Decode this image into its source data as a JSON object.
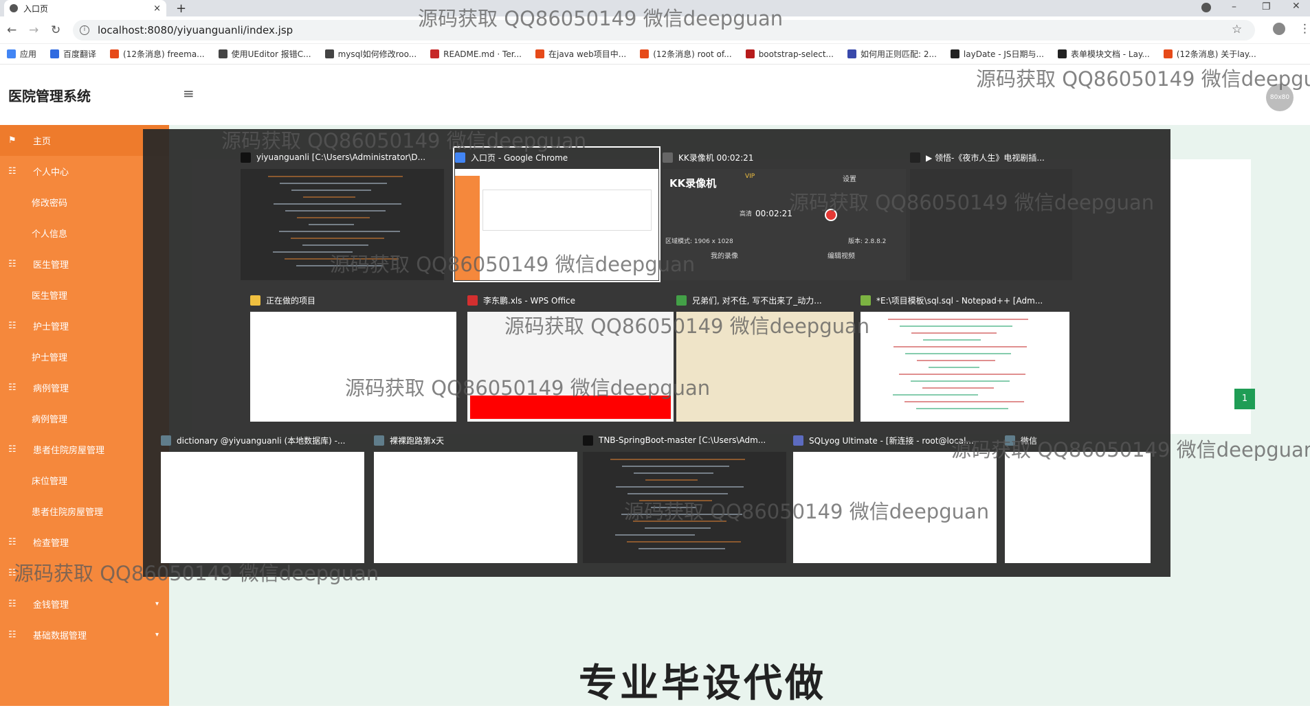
{
  "browser": {
    "tab_title": "入口页",
    "tab_close": "×",
    "new_tab": "+",
    "url": "localhost:8080/yiyuanguanli/index.jsp",
    "bookmarks": [
      {
        "label": "应用",
        "color": "#4285f4"
      },
      {
        "label": "百度翻译",
        "color": "#2f6ae0"
      },
      {
        "label": "(12条消息) freema...",
        "color": "#e64a19"
      },
      {
        "label": "使用UEditor 报错C...",
        "color": "#444444"
      },
      {
        "label": "mysql如何修改roo...",
        "color": "#444444"
      },
      {
        "label": "README.md · Ter...",
        "color": "#c62828"
      },
      {
        "label": "在java web项目中...",
        "color": "#e64a19"
      },
      {
        "label": "(12条消息) root of...",
        "color": "#e64a19"
      },
      {
        "label": "bootstrap-select...",
        "color": "#b71c1c"
      },
      {
        "label": "如何用正则匹配: 2...",
        "color": "#3949ab"
      },
      {
        "label": "layDate - JS日期与...",
        "color": "#222222"
      },
      {
        "label": "表单模块文档 - Lay...",
        "color": "#222222"
      },
      {
        "label": "(12条消息) 关于lay...",
        "color": "#e64a19"
      }
    ]
  },
  "app": {
    "brand": "医院管理系统",
    "avatar_text": "80x80",
    "menu": [
      {
        "label": "主页",
        "type": "top",
        "icon": "flag-icon"
      },
      {
        "label": "个人中心",
        "type": "group"
      },
      {
        "label": "修改密码",
        "type": "sub"
      },
      {
        "label": "个人信息",
        "type": "sub"
      },
      {
        "label": "医生管理",
        "type": "group"
      },
      {
        "label": "医生管理",
        "type": "sub"
      },
      {
        "label": "护士管理",
        "type": "group"
      },
      {
        "label": "护士管理",
        "type": "sub"
      },
      {
        "label": "病例管理",
        "type": "group"
      },
      {
        "label": "病例管理",
        "type": "sub"
      },
      {
        "label": "患者住院房屋管理",
        "type": "group"
      },
      {
        "label": "床位管理",
        "type": "sub"
      },
      {
        "label": "患者住院房屋管理",
        "type": "sub"
      },
      {
        "label": "检查管理",
        "type": "group"
      },
      {
        "label": "",
        "type": "group"
      },
      {
        "label": "金钱管理",
        "type": "group",
        "arrow": true
      },
      {
        "label": "基础数据管理",
        "type": "group",
        "arrow": true
      }
    ],
    "pagination_current": "1"
  },
  "switcher": {
    "windows": [
      {
        "title": "yiyuanguanli [C:\\Users\\Administrator\\D...",
        "icon_color": "#111111",
        "theme": "dark"
      },
      {
        "title": "入口页 - Google Chrome",
        "icon_color": "#4285f4",
        "theme": "app",
        "selected": true
      },
      {
        "title": "KK录像机 00:02:21",
        "icon_color": "#666666",
        "theme": "kk"
      },
      {
        "title": "▶ 领悟-《夜市人生》电视剧插...",
        "icon_color": "#222222",
        "theme": "music"
      },
      {
        "title": "正在做的项目",
        "icon_color": "#f0c040",
        "theme": "explorer"
      },
      {
        "title": "李东鹏.xls - WPS Office",
        "icon_color": "#d32f2f",
        "theme": "excel"
      },
      {
        "title": "兄弟们, 对不住, 写不出来了_动力...",
        "icon_color": "#43a047",
        "theme": "web"
      },
      {
        "title": "*E:\\项目模板\\sql.sql - Notepad++ [Adm...",
        "icon_color": "#7cb342",
        "theme": "notepad"
      },
      {
        "title": "dictionary @yiyuanguanli (本地数据库) -...",
        "icon_color": "#607d8b",
        "theme": "db"
      },
      {
        "title": "裸裸跑路第x天",
        "icon_color": "#607d8b",
        "theme": "chat"
      },
      {
        "title": "TNB-SpringBoot-master [C:\\Users\\Adm...",
        "icon_color": "#111111",
        "theme": "dark"
      },
      {
        "title": "SQLyog Ultimate - [新连接 - root@local...",
        "icon_color": "#5c6bc0",
        "theme": "sqlyog"
      },
      {
        "title": "微信",
        "icon_color": "#607d8b",
        "theme": "wechat"
      }
    ],
    "kk": {
      "brand": "KK录像机",
      "time": "00:02:21",
      "quality": "高清",
      "settings": "设置",
      "area": "区域模式: 1906 x 1028",
      "version": "版本: 2.8.8.2",
      "my_rec": "我的录像",
      "edit": "编辑视频",
      "vip": "VIP"
    }
  },
  "watermarks": [
    "源码获取 QQ86050149 微信deepguan",
    "源码获取 QQ86050149 微信deepguan",
    "源码获取 QQ86050149 微信deepguan",
    "源码获取 QQ86050149 微信deepguan",
    "源码获取 QQ86050149 微信deepguan",
    "源码获取 QQ86050149 微信deepguan",
    "源码获取 QQ86050149 微信deepguan",
    "源码获取 QQ86050149 微信deepguan",
    "源码获取 QQ86050149 微信deepguan",
    "源码获取 QQ86050149 微信deepguan"
  ],
  "banner": "专业毕设代做"
}
